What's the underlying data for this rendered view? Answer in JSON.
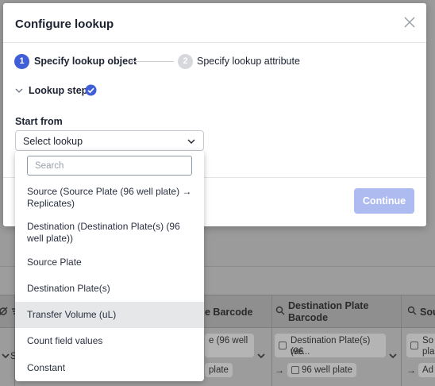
{
  "modal": {
    "title": "Configure lookup",
    "steps": [
      {
        "number": "1",
        "label": "Specify lookup object"
      },
      {
        "number": "2",
        "label": "Specify lookup attribute"
      }
    ],
    "section_label": "Lookup step",
    "start_from_label": "Start from",
    "select_value": "Select lookup",
    "continue_label": "Continue",
    "colors": {
      "accent": "#3f5ed8",
      "continue_disabled": "#aebbf0"
    }
  },
  "dropdown": {
    "search_placeholder": "Search",
    "options": [
      {
        "label": "Source (Source Plate (96 well plate) → Replicates)"
      },
      {
        "label": "Destination (Destination Plate(s) (96 well plate))"
      },
      {
        "label": "Source Plate"
      },
      {
        "label": "Destination Plate(s)"
      },
      {
        "label": "Transfer Volume (uL)"
      },
      {
        "label": "Count field values"
      },
      {
        "label": "Constant"
      }
    ],
    "highlighted_index": 4
  },
  "background": {
    "headers": {
      "col_barcode": "e Barcode",
      "col_dest": "Destination Plate Barcode",
      "col_sou": "Sou"
    },
    "cells": {
      "left_s": "S",
      "chip_a_top": "e (96 well",
      "chip_a_bottom": "plate",
      "chip_b_top": "Destination Plate(s) (96",
      "chip_b_mid": "we...",
      "chip_b_bottom": "96 well plate",
      "chip_c_top": "So",
      "chip_c_mid": "pla",
      "chip_c_bottom": "Ad",
      "arrow": "→"
    }
  }
}
